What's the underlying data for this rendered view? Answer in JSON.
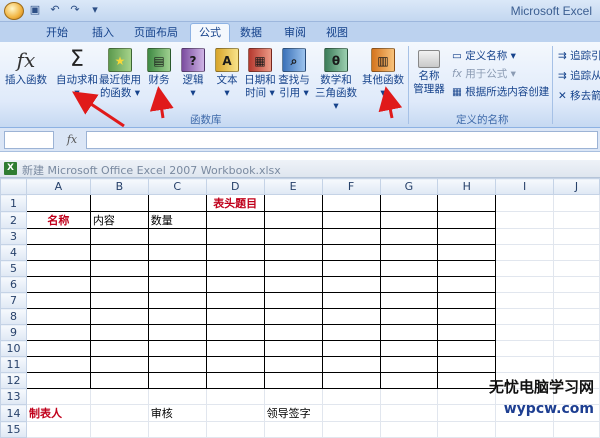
{
  "app": {
    "title": "Microsoft Excel"
  },
  "tabs": [
    "开始",
    "插入",
    "页面布局",
    "公式",
    "数据",
    "审阅",
    "视图"
  ],
  "active_tab": "公式",
  "ribbon": {
    "insert_function": "插入函数",
    "autosum": "自动求和",
    "recent_1": "最近使用",
    "recent_2": "的函数",
    "financial": "财务",
    "logical": "逻辑",
    "text": "文本",
    "datetime_1": "日期和",
    "datetime_2": "时间",
    "lookup_1": "查找与",
    "lookup_2": "引用",
    "math_1": "数学和",
    "math_2": "三角函数",
    "other": "其他函数",
    "name_mgr_1": "名称",
    "name_mgr_2": "管理器",
    "define_name": "定义名称",
    "use_in_formula": "用于公式",
    "create_from_sel": "根据所选内容创建",
    "trace_prec": "追踪引",
    "trace_dep": "追踪从",
    "remove_arrows": "移去箭",
    "group_function_library": "函数库",
    "group_defined_names": "定义的名称"
  },
  "formula_bar": {
    "fx": "fx",
    "name_box": "",
    "value": ""
  },
  "workbook": {
    "title": "新建 Microsoft Office Excel 2007 Workbook.xlsx"
  },
  "sheet": {
    "columns": [
      "A",
      "B",
      "C",
      "D",
      "E",
      "F",
      "G",
      "H",
      "I",
      "J"
    ],
    "rows": [
      "1",
      "2",
      "3",
      "4",
      "5",
      "6",
      "7",
      "8",
      "9",
      "10",
      "11",
      "12",
      "13",
      "14",
      "15"
    ],
    "header_title": "表头题目",
    "name_label": "名称",
    "content_label": "内容",
    "qty_label": "数量",
    "maker": "制表人",
    "review": "审核",
    "leader_sign": "领导签字"
  },
  "watermark": {
    "line1": "无忧电脑学习网",
    "line2": "wypcw.com"
  },
  "colors": {
    "accent_red": "#c0001b",
    "ribbon_text": "#15428b"
  },
  "icons": {
    "insert_function": "fx-icon",
    "autosum": "sigma-icon",
    "recent": "star-book-icon",
    "financial": "book-green-icon",
    "logical": "book-purple-question-icon",
    "text": "book-yellow-a-icon",
    "datetime": "book-red-calendar-icon",
    "lookup": "book-blue-magnifier-icon",
    "math": "book-green-theta-icon",
    "other": "book-orange-icon"
  }
}
